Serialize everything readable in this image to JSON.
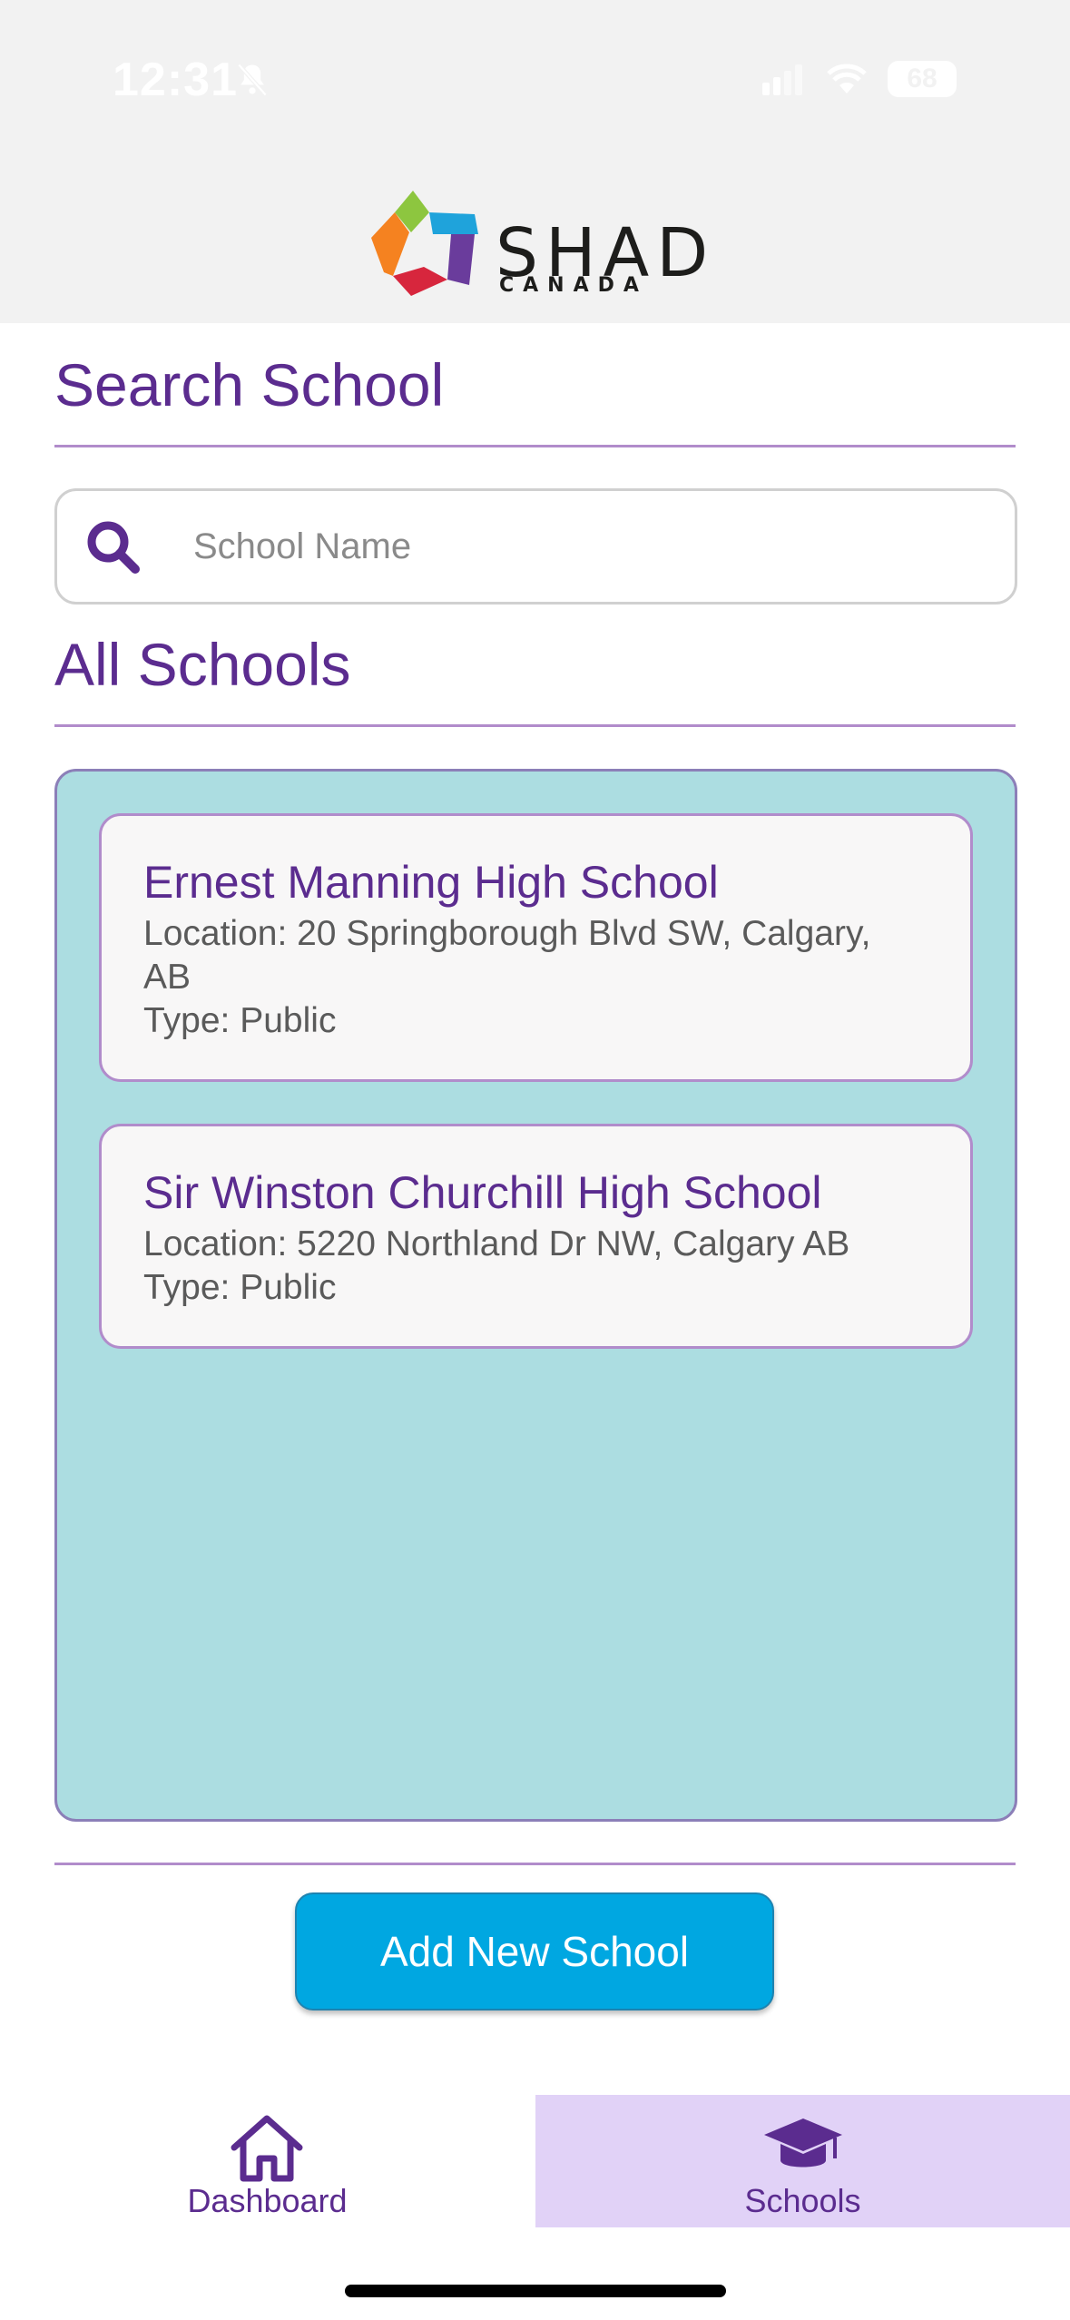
{
  "status_bar": {
    "time": "12:31",
    "battery": "68"
  },
  "brand": {
    "name": "SHAD",
    "sub": "CANADA"
  },
  "search": {
    "title": "Search School",
    "placeholder": "School Name"
  },
  "list": {
    "title": "All Schools",
    "schools": [
      {
        "name": "Ernest Manning High School",
        "location_line1": "Location: 20 Springborough Blvd SW, Calgary,",
        "location_line2": "AB",
        "type": "Type: Public"
      },
      {
        "name": "Sir Winston Churchill High School",
        "location_line1": "Location: 5220 Northland Dr NW, Calgary AB",
        "type": "Type: Public"
      }
    ]
  },
  "actions": {
    "add_label": "Add New School"
  },
  "tabs": [
    {
      "label": "Dashboard",
      "icon": "home-icon"
    },
    {
      "label": "Schools",
      "icon": "graduation-cap-icon",
      "active": true
    }
  ],
  "colors": {
    "accent": "#5b2c8f",
    "panel": "#acdde1",
    "button": "#00a7e1",
    "active_tab": "#e1d2f7"
  }
}
